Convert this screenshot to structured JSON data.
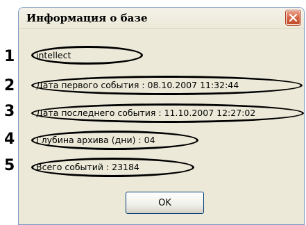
{
  "dialog": {
    "title": "Информация о базе",
    "close_label": "Закрыть"
  },
  "annotations": [
    "1",
    "2",
    "3",
    "4",
    "5"
  ],
  "fields": {
    "name": "intellect",
    "first_event": "Дата первого события : 08.10.2007 11:32:44",
    "last_event": "Дата последнего события : 11.10.2007 12:27:02",
    "archive_depth": "Глубина архива (дни) : 04",
    "total_events": "Всего событий : 23184"
  },
  "buttons": {
    "ok_label": "OK"
  },
  "icons": {
    "close": "close-icon"
  },
  "colors": {
    "dialog_bg": "#ece9d8",
    "close_button": "#d3623f",
    "annotation": "#000000"
  }
}
